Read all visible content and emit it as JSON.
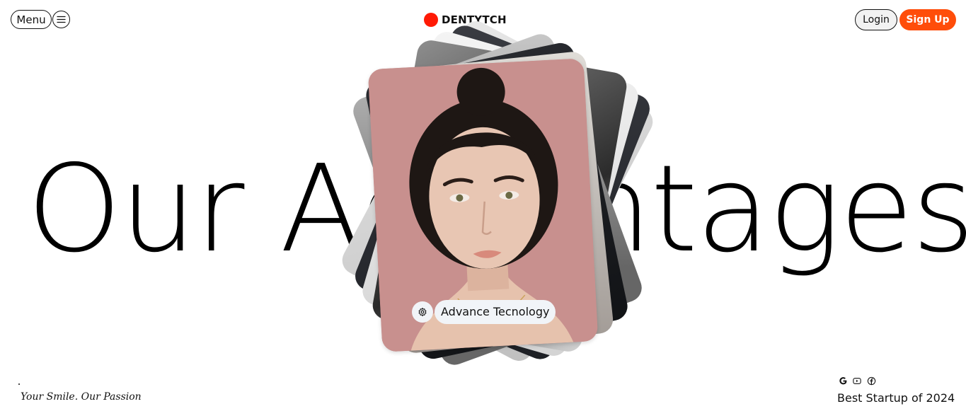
{
  "header": {
    "menu_label": "Menu",
    "menu_icon": "hamburger-icon",
    "brand_name": "DENTYTCH",
    "brand_color": "#ff1a05",
    "login_label": "Login",
    "signup_label": "Sign Up",
    "signup_color": "#ff4d0a"
  },
  "hero": {
    "headline": "Our Advantages",
    "card_tag_icon": "gear-icon",
    "card_tag_label": "Advance Tecnology"
  },
  "footer": {
    "tagline": "Your Smile. Our Passion",
    "social_icons": [
      "google-icon",
      "youtube-icon",
      "facebook-icon"
    ],
    "award_text": "Best Startup of 2024"
  }
}
